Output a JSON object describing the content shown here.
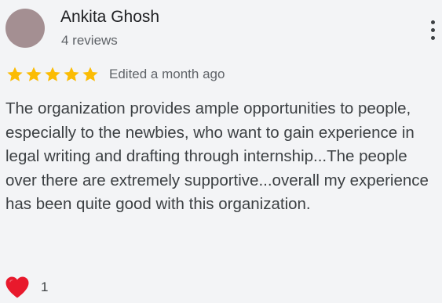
{
  "review": {
    "author_name": "Ankita Ghosh",
    "review_count": "4 reviews",
    "rating": 5,
    "rating_max": 5,
    "edited": "Edited a month ago",
    "text": "The organization provides ample opportunities to people, especially to the newbies, who want to gain experience in legal writing and drafting through internship...The people over there are extremely supportive...overall my experience has been quite good with this organization.",
    "reaction_icon": "heart-icon",
    "reaction_count": "1",
    "more_icon": "more-vert-icon"
  },
  "colors": {
    "background": "#f3f4f6",
    "star": "#fbbc04",
    "heart": "#e8192c",
    "avatar": "#a48f92"
  }
}
